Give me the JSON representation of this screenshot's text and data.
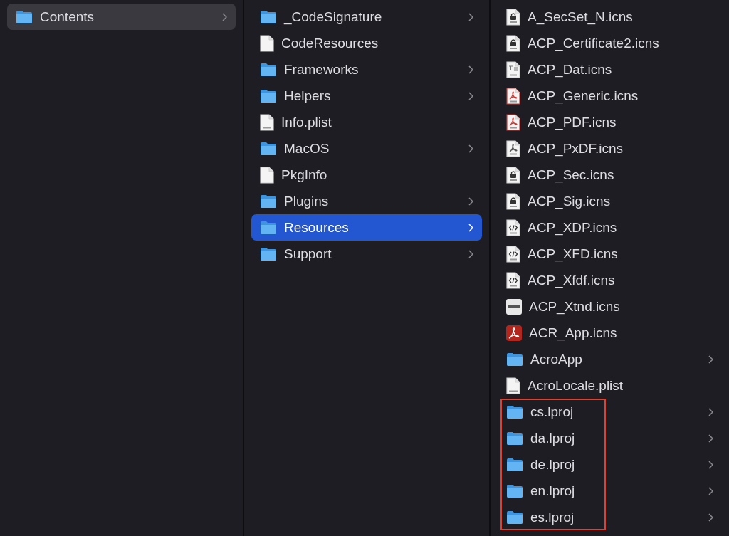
{
  "columns": [
    {
      "items": [
        {
          "name": "Contents",
          "kind": "folder",
          "has_children": true,
          "selected": true
        }
      ]
    },
    {
      "items": [
        {
          "name": "_CodeSignature",
          "kind": "folder",
          "has_children": true,
          "selected": false
        },
        {
          "name": "CodeResources",
          "kind": "blank",
          "has_children": false,
          "selected": false
        },
        {
          "name": "Frameworks",
          "kind": "folder",
          "has_children": true,
          "selected": false
        },
        {
          "name": "Helpers",
          "kind": "folder",
          "has_children": true,
          "selected": false
        },
        {
          "name": "Info.plist",
          "kind": "plist",
          "has_children": false,
          "selected": false
        },
        {
          "name": "MacOS",
          "kind": "folder",
          "has_children": true,
          "selected": false
        },
        {
          "name": "PkgInfo",
          "kind": "blank",
          "has_children": false,
          "selected": false
        },
        {
          "name": "Plugins",
          "kind": "folder",
          "has_children": true,
          "selected": false
        },
        {
          "name": "Resources",
          "kind": "folder",
          "has_children": true,
          "selected": true
        },
        {
          "name": "Support",
          "kind": "folder",
          "has_children": true,
          "selected": false
        }
      ]
    },
    {
      "items": [
        {
          "name": "A_SecSet_N.icns",
          "kind": "lock",
          "has_children": false,
          "selected": false
        },
        {
          "name": "ACP_Certificate2.icns",
          "kind": "lock",
          "has_children": false,
          "selected": false
        },
        {
          "name": "ACP_Dat.icns",
          "kind": "text",
          "has_children": false,
          "selected": false
        },
        {
          "name": "ACP_Generic.icns",
          "kind": "pdf",
          "has_children": false,
          "selected": false
        },
        {
          "name": "ACP_PDF.icns",
          "kind": "pdf",
          "has_children": false,
          "selected": false
        },
        {
          "name": "ACP_PxDF.icns",
          "kind": "pdfplain",
          "has_children": false,
          "selected": false
        },
        {
          "name": "ACP_Sec.icns",
          "kind": "lock",
          "has_children": false,
          "selected": false
        },
        {
          "name": "ACP_Sig.icns",
          "kind": "lock",
          "has_children": false,
          "selected": false
        },
        {
          "name": "ACP_XDP.icns",
          "kind": "code",
          "has_children": false,
          "selected": false
        },
        {
          "name": "ACP_XFD.icns",
          "kind": "code",
          "has_children": false,
          "selected": false
        },
        {
          "name": "ACP_Xfdf.icns",
          "kind": "code",
          "has_children": false,
          "selected": false
        },
        {
          "name": "ACP_Xtnd.icns",
          "kind": "extension",
          "has_children": false,
          "selected": false
        },
        {
          "name": "ACR_App.icns",
          "kind": "acrobat",
          "has_children": false,
          "selected": false
        },
        {
          "name": "AcroApp",
          "kind": "folder",
          "has_children": true,
          "selected": false
        },
        {
          "name": "AcroLocale.plist",
          "kind": "plist",
          "has_children": false,
          "selected": false
        }
      ],
      "outlined_group": {
        "items": [
          {
            "name": "cs.lproj",
            "kind": "folder",
            "has_children": true,
            "selected": false
          },
          {
            "name": "da.lproj",
            "kind": "folder",
            "has_children": true,
            "selected": false
          },
          {
            "name": "de.lproj",
            "kind": "folder",
            "has_children": true,
            "selected": false
          },
          {
            "name": "en.lproj",
            "kind": "folder",
            "has_children": true,
            "selected": false
          },
          {
            "name": "es.lproj",
            "kind": "folder",
            "has_children": true,
            "selected": false
          }
        ]
      }
    }
  ]
}
